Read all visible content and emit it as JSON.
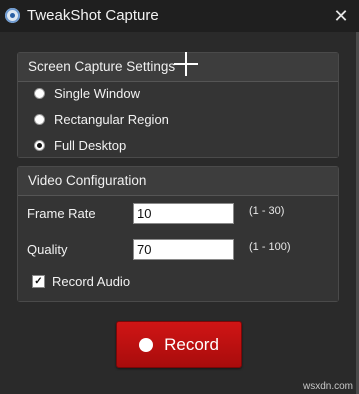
{
  "window": {
    "title": "TweakShot Capture",
    "close_glyph": "✕",
    "icon": "app-icon"
  },
  "capture_settings": {
    "header": "Screen Capture Settings",
    "options": [
      {
        "label": "Single Window",
        "checked": false
      },
      {
        "label": "Rectangular Region",
        "checked": false
      },
      {
        "label": "Full Desktop",
        "checked": true
      }
    ]
  },
  "video_config": {
    "header": "Video Configuration",
    "frame_rate": {
      "label": "Frame Rate",
      "value": "10",
      "range": "(1 - 30)"
    },
    "quality": {
      "label": "Quality",
      "value": "70",
      "range": "(1 - 100)"
    },
    "record_audio": {
      "label": "Record Audio",
      "checked": true,
      "check_glyph": "✓"
    }
  },
  "record_button": {
    "label": "Record"
  },
  "watermark": "wsxdn.com",
  "colors": {
    "accent_red": "#c81212",
    "background": "#2a2a2a",
    "panel": "#3a3a3a"
  }
}
